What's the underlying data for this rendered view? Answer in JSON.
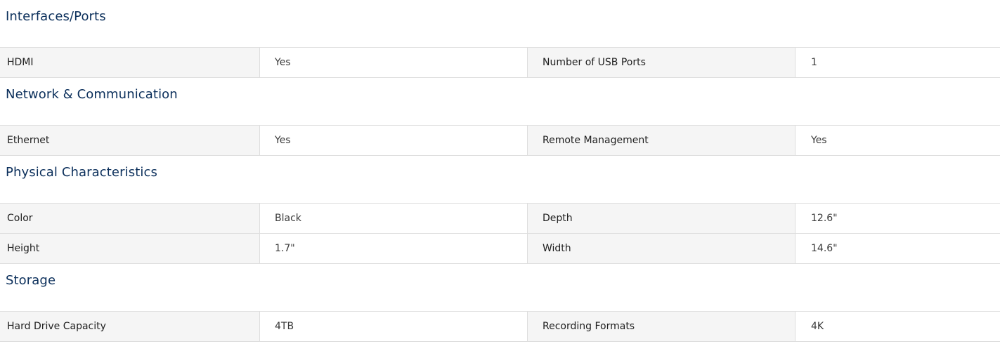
{
  "sections": [
    {
      "title": "Interfaces/Ports",
      "rows": [
        [
          "HDMI",
          "Yes",
          "Number of USB Ports",
          "1"
        ]
      ]
    },
    {
      "title": "Network & Communication",
      "rows": [
        [
          "Ethernet",
          "Yes",
          "Remote Management",
          "Yes"
        ]
      ]
    },
    {
      "title": "Physical Characteristics",
      "rows": [
        [
          "Color",
          "Black",
          "Depth",
          "12.6\""
        ],
        [
          "Height",
          "1.7\"",
          "Width",
          "14.6\""
        ]
      ]
    },
    {
      "title": "Storage",
      "rows": [
        [
          "Hard Drive Capacity",
          "4TB",
          "Recording Formats",
          "4K"
        ]
      ]
    }
  ]
}
